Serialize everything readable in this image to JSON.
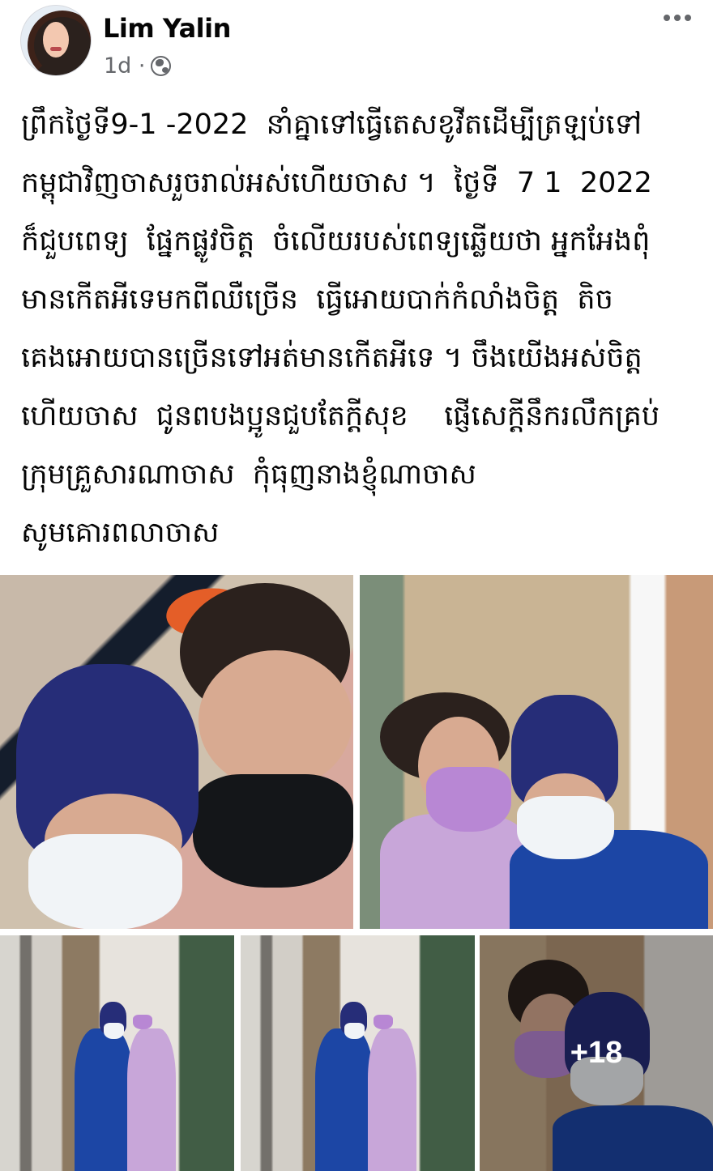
{
  "post": {
    "author": "Lim Yalin",
    "time": "1d ·",
    "privacy_icon": "globe-icon",
    "menu_icon": "more-horizontal-icon",
    "text": "ព្រឹកថ្ងៃទី9-1 -2022  នាំគ្នាទៅធ្វើតេសខូវីតដើម្បីត្រឡប់ទៅ\nកម្ពុជាវិញចាសរួចរាល់អស់ហើយចាស ។  ថ្ងៃទី  7 1  2022\nក៏ជួបពេទ្យ  ផ្នែកផ្លូវចិត្ត  ចំលើយរបស់ពេទ្យឆ្លើយថា អ្នកអែងពុំ\nមានកើតអីទេមកពីឈឺច្រើន  ធ្វើអោយបាក់កំលាំងចិត្ត  តិច\nគេងអោយបានច្រើនទៅអត់មានកើតអីទេ ។ ចឹងយើងអស់ចិត្ត\nហើយចាស  ជូនពបងប្អូនជួបតែក្តីសុខ    ផ្ញើសេក្តីនឹករលឹកគ្រប់\nក្រុមគ្រួសារណាចាស  កុំធុញនាងខ្ញុំណាចាស\nសូមគោរពលាចាស"
  },
  "photos": {
    "more_count": "+18"
  }
}
